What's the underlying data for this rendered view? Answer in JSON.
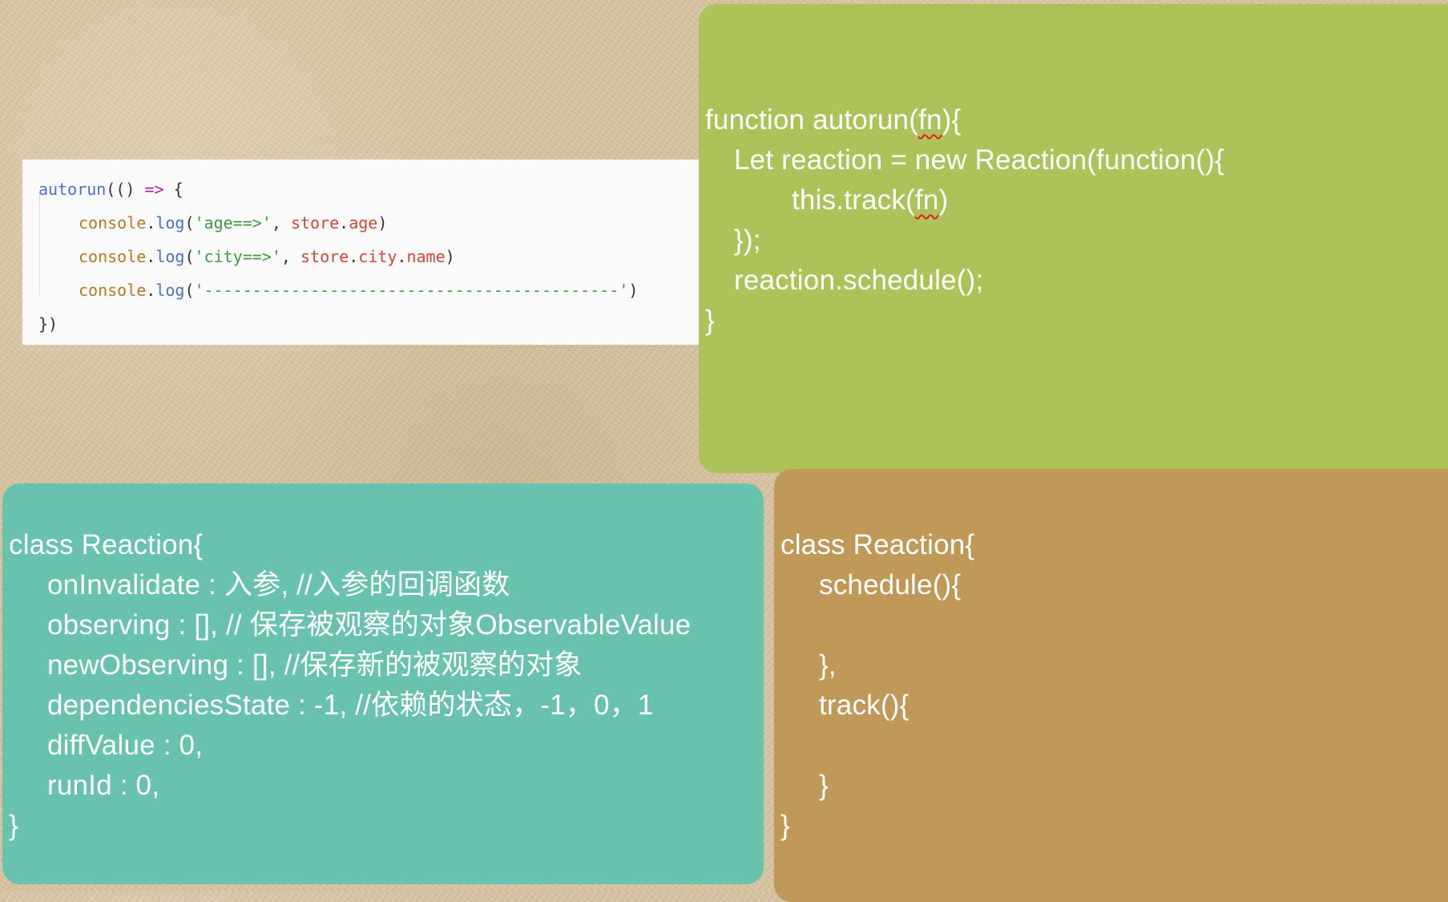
{
  "snippet": {
    "line1": {
      "fn": "autorun",
      "punct1": "(() ",
      "arrow": "=>",
      "punct2": " {"
    },
    "line2": {
      "obj": "console",
      "dot": ".",
      "method": "log",
      "open": "(",
      "str": "'age==>'",
      "comma": ", ",
      "store": "store",
      "dot2": ".",
      "prop": "age",
      "close": ")"
    },
    "line3": {
      "obj": "console",
      "dot": ".",
      "method": "log",
      "open": "(",
      "str": "'city==>'",
      "comma": ", ",
      "store": "store",
      "dot2": ".",
      "prop": "city",
      "dot3": ".",
      "prop2": "name",
      "close": ")"
    },
    "line4": {
      "obj": "console",
      "dot": ".",
      "method": "log",
      "open": "(",
      "str": "'-------------------------------------------'",
      "close": ")"
    },
    "line5": "})"
  },
  "green_card": {
    "line1_pre": "function autorun(",
    "line1_fn": "fn",
    "line1_post": "){",
    "line2": "Let reaction = new Reaction(function(){",
    "line3_pre": "this.track(",
    "line3_fn": "fn",
    "line3_post": ")",
    "line4": "});",
    "line5": "reaction.schedule();",
    "line6": "}"
  },
  "teal_card": {
    "line1": "class Reaction{",
    "line2": "onInvalidate : 入参, //入参的回调函数",
    "line3": "observing : [], // 保存被观察的对象ObservableValue",
    "line4": "newObserving : [], //保存新的被观察的对象",
    "line5": "dependenciesState : -1, //依赖的状态，-1，0，1",
    "line6": "diffValue : 0,",
    "line7": "runId : 0,",
    "line8": "}"
  },
  "tan_card": {
    "line1": "class Reaction{",
    "line2": "schedule(){",
    "line3": "",
    "line4": "},",
    "line5": "track(){",
    "line6": "",
    "line7": "}",
    "line8": "}"
  },
  "colors": {
    "green": "#adc35a",
    "teal": "#68c2ae",
    "tan": "#c09959",
    "background": "#d8c4a2"
  }
}
